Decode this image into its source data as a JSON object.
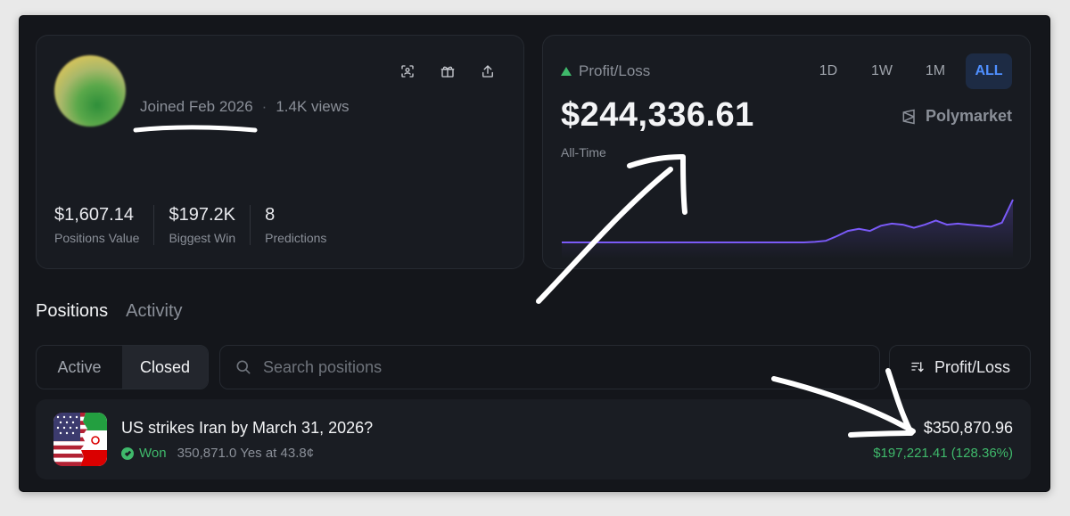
{
  "profile": {
    "joined": "Joined Feb 2026",
    "separator": "·",
    "views": "1.4K views",
    "actions": [
      {
        "name": "scan-icon"
      },
      {
        "name": "gift-icon"
      },
      {
        "name": "share-icon"
      }
    ],
    "stats": [
      {
        "value": "$1,607.14",
        "label": "Positions Value"
      },
      {
        "value": "$197.2K",
        "label": "Biggest Win"
      },
      {
        "value": "8",
        "label": "Predictions"
      }
    ]
  },
  "pnl": {
    "title": "Profit/Loss",
    "value": "$244,336.61",
    "period": "All-Time",
    "brand": "Polymarket",
    "ranges": [
      "1D",
      "1W",
      "1M",
      "ALL"
    ],
    "active_range": "ALL",
    "line_color": "#7a5af8",
    "up_color": "#3fb96b"
  },
  "tabs": [
    "Positions",
    "Activity"
  ],
  "filters": {
    "segments": [
      "Active",
      "Closed"
    ],
    "active_segment": "Closed",
    "search_placeholder": "Search positions",
    "sort_label": "Profit/Loss"
  },
  "positions": [
    {
      "title": "US strikes Iran by March 31, 2026?",
      "status": "Won",
      "detail": "350,871.0 Yes at 43.8¢",
      "value": "$350,870.96",
      "gain": "$197,221.41 (128.36%)"
    }
  ],
  "chart_data": {
    "type": "area",
    "series": [
      {
        "values": [
          0,
          0,
          0,
          0,
          0,
          0,
          0,
          0,
          0,
          0,
          0,
          0,
          0,
          0,
          0,
          0,
          0,
          0,
          0,
          0,
          0,
          0,
          0,
          0.5,
          1.5,
          6,
          11,
          13,
          11,
          16,
          18,
          17,
          14,
          17,
          21,
          17,
          18,
          17,
          16,
          15,
          19,
          41
        ]
      }
    ]
  }
}
